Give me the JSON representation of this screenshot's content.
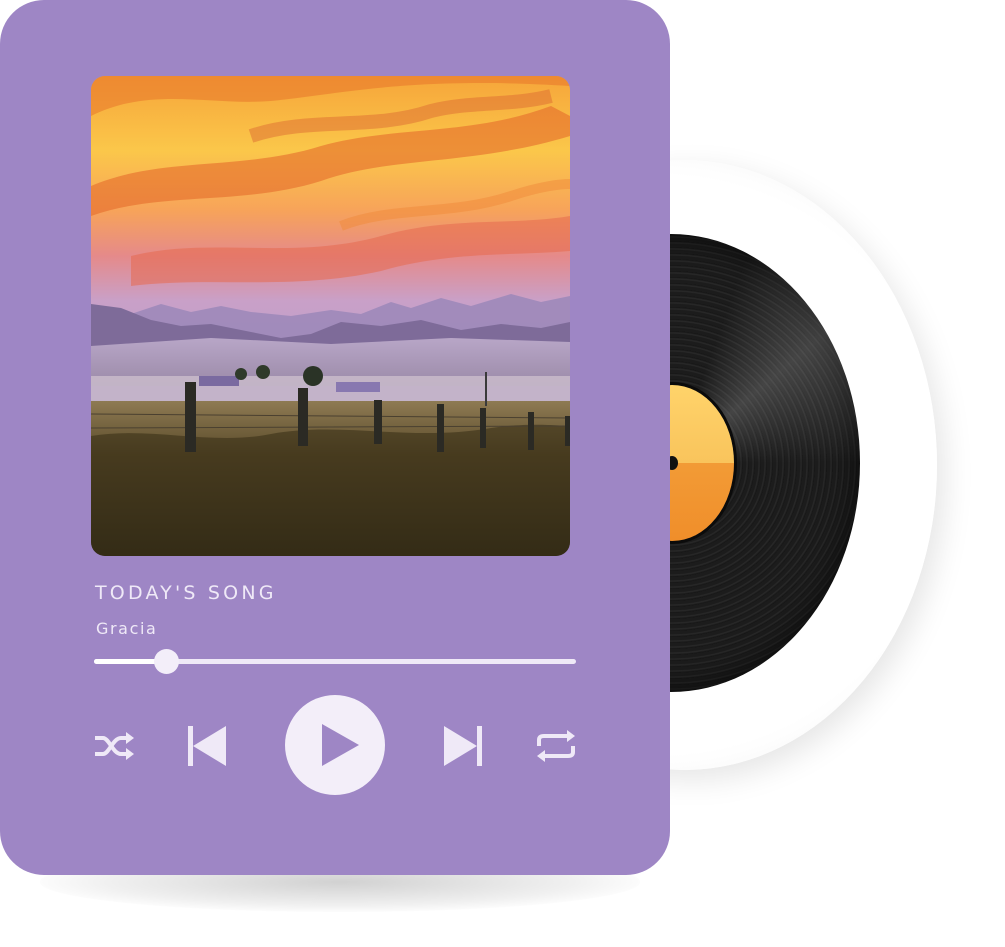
{
  "player": {
    "heading": "TODAY'S SONG",
    "song": "Gracia",
    "progress": 0.15,
    "artwork": "sunset-prairie-landscape"
  },
  "controls": {
    "shuffle_icon": "shuffle-icon",
    "previous_icon": "skip-previous-icon",
    "play_icon": "play-icon",
    "next_icon": "skip-next-icon",
    "repeat_icon": "repeat-icon"
  },
  "colors": {
    "card": "#9e86c5",
    "text": "#efe9f7",
    "vinyl": "#111111",
    "label_top": "#ffd36a",
    "label_bottom": "#f08e2a"
  }
}
